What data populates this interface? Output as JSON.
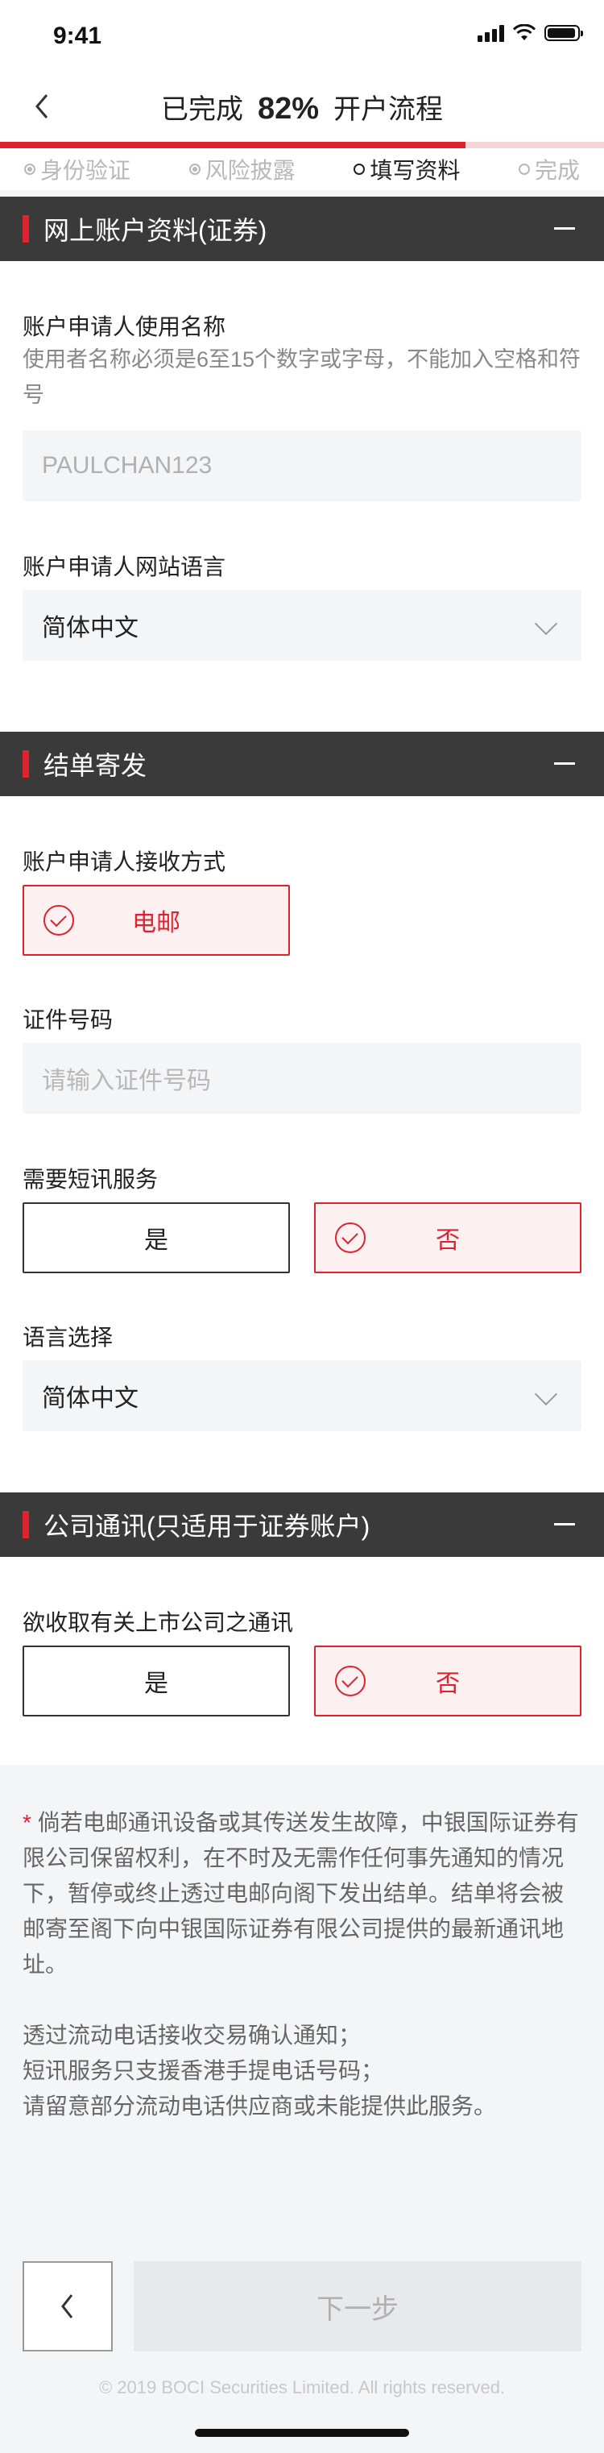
{
  "status_bar": {
    "time": "9:41"
  },
  "nav": {
    "title_prefix": "已完成",
    "percent": "82%",
    "title_suffix": "开户流程",
    "progress": 0.77
  },
  "steps": [
    {
      "label": "身份验证",
      "state": "done"
    },
    {
      "label": "风险披露",
      "state": "done"
    },
    {
      "label": "填写资料",
      "state": "active"
    },
    {
      "label": "完成",
      "state": "todo"
    }
  ],
  "section1": {
    "title": "网上账户资料(证券)",
    "username_label": "账户申请人使用名称",
    "username_hint": "使用者名称必须是6至15个数字或字母，不能加入空格和符号",
    "username_value": "PAULCHAN123",
    "lang_label": "账户申请人网站语言",
    "lang_value": "简体中文"
  },
  "section2": {
    "title": "结单寄发",
    "receive_label": "账户申请人接收方式",
    "receive_option": "电邮",
    "id_label": "证件号码",
    "id_placeholder": "请输入证件号码",
    "sms_label": "需要短讯服务",
    "sms_yes": "是",
    "sms_no": "否",
    "lang2_label": "语言选择",
    "lang2_value": "简体中文"
  },
  "section3": {
    "title": "公司通讯(只适用于证券账户)",
    "comm_label": "欲收取有关上市公司之通讯",
    "comm_yes": "是",
    "comm_no": "否"
  },
  "notice": {
    "star": "*",
    "para1": "倘若电邮通讯设备或其传送发生故障，中银国际证券有限公司保留权利，在不时及无需作任何事先通知的情况下，暂停或终止透过电邮向阁下发出结单。结单将会被邮寄至阁下向中银国际证券有限公司提供的最新通讯地址。",
    "line1": "透过流动电话接收交易确认通知；",
    "line2": "短讯服务只支援香港手提电话号码；",
    "line3": "请留意部分流动电话供应商或未能提供此服务。"
  },
  "footer": {
    "next_label": "下一步",
    "copyright": "© 2019 BOCI Securities Limited. All rights reserved."
  },
  "colors": {
    "accent": "#e0222f",
    "header_bg": "#3a3a3a",
    "page_bg": "#f4f5f7"
  }
}
